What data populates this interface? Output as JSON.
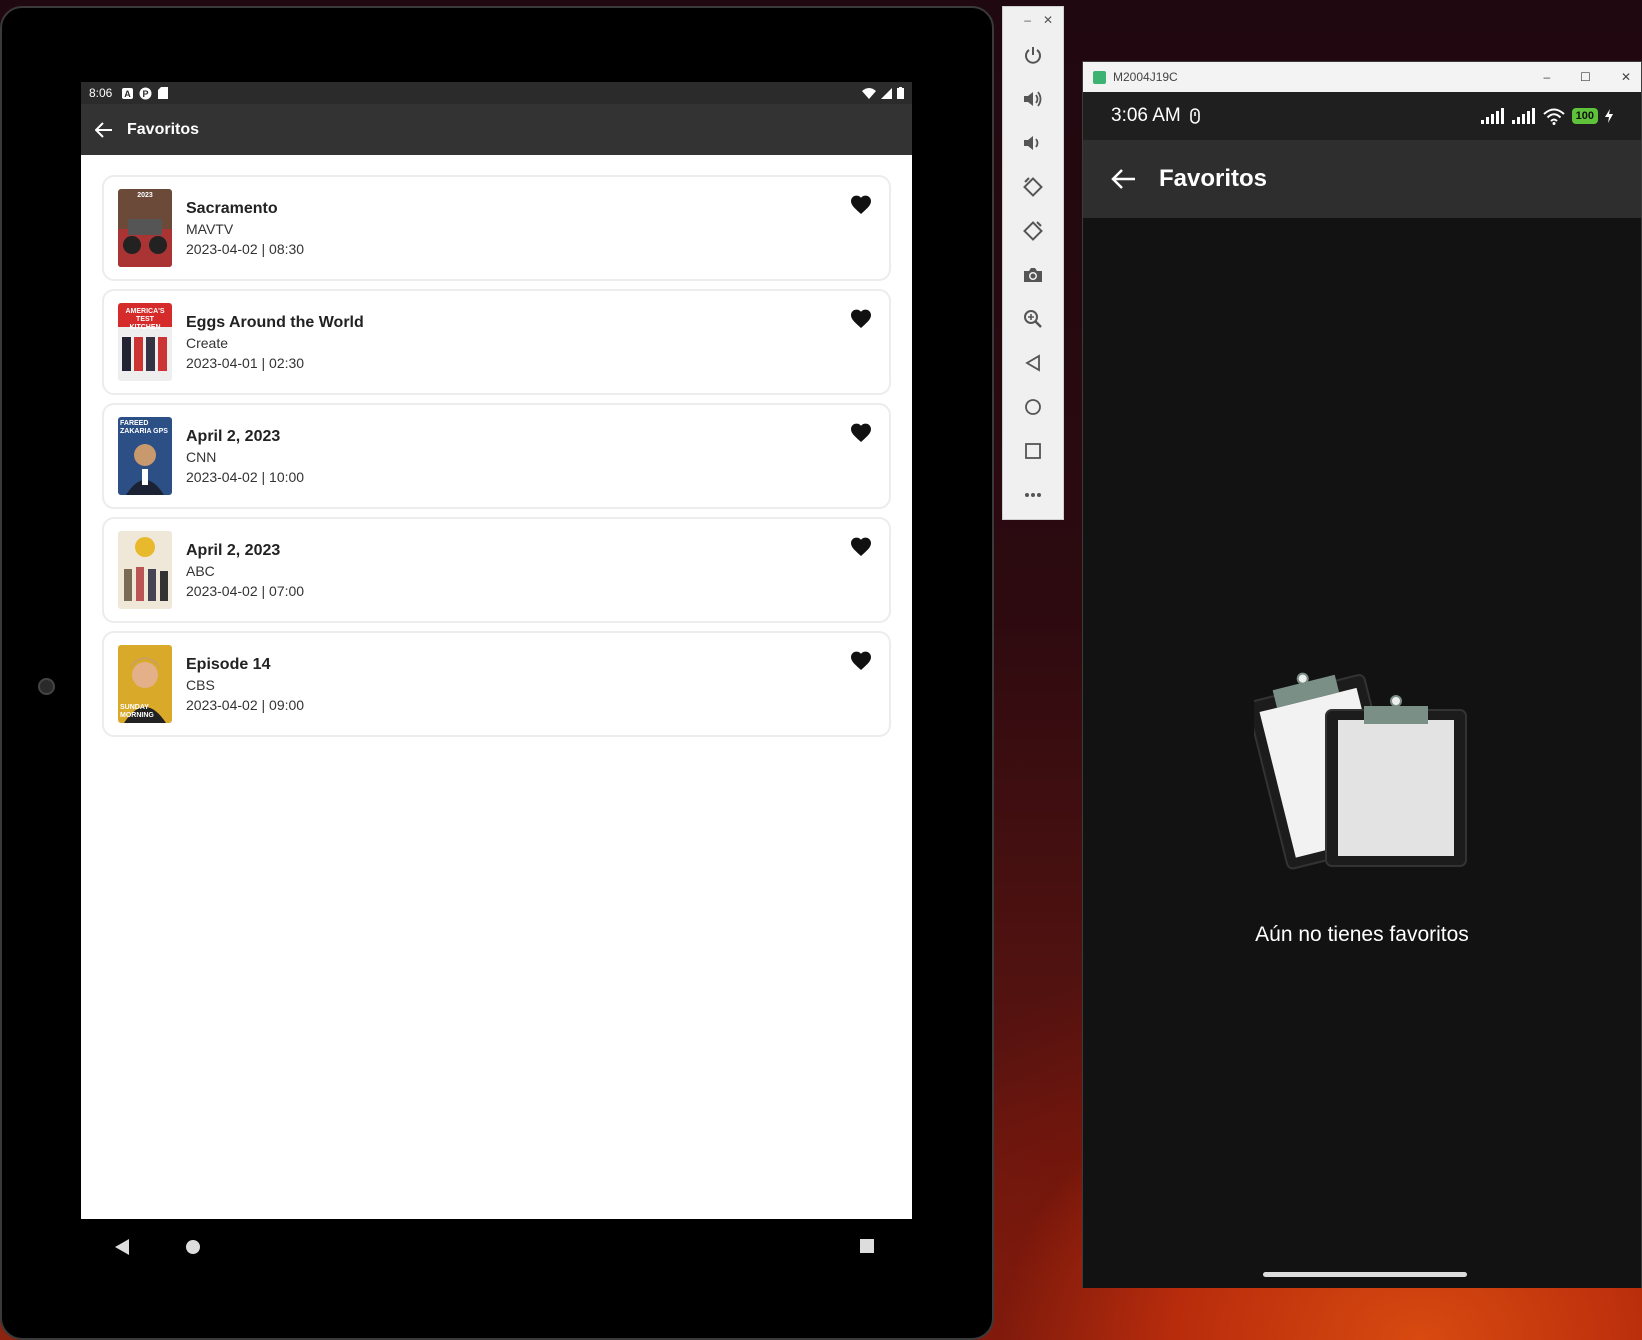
{
  "tablet": {
    "status_time": "8:06",
    "app_title": "Favoritos",
    "favorites": [
      {
        "title": "Sacramento",
        "channel": "MAVTV",
        "datetime": "2023-04-02 | 08:30",
        "thumb_color": "#6b4a3a",
        "thumb_text": "2023"
      },
      {
        "title": "Eggs Around the World",
        "channel": "Create",
        "datetime": "2023-04-01 | 02:30",
        "thumb_color": "#d52b2b",
        "thumb_text": "AMERICA'S TEST KITCHEN"
      },
      {
        "title": "April 2, 2023",
        "channel": "CNN",
        "datetime": "2023-04-02 | 10:00",
        "thumb_color": "#2c4f86",
        "thumb_text": "FAREED ZAKARIA GPS"
      },
      {
        "title": "April 2, 2023",
        "channel": "ABC",
        "datetime": "2023-04-02 | 07:00",
        "thumb_color": "#b89a55",
        "thumb_text": ""
      },
      {
        "title": "Episode 14",
        "channel": "CBS",
        "datetime": "2023-04-02 | 09:00",
        "thumb_color": "#d9a92a",
        "thumb_text": "SUNDAY MORNING"
      }
    ]
  },
  "emulator_toolbar": {
    "tools": [
      "power-icon",
      "volume-up-icon",
      "volume-down-icon",
      "rotate-left-icon",
      "rotate-right-icon",
      "camera-icon",
      "zoom-icon",
      "back-icon",
      "home-icon",
      "overview-icon",
      "more-icon"
    ]
  },
  "phone": {
    "window_title": "M2004J19C",
    "status_time": "3:06 AM",
    "battery": "100",
    "app_title": "Favoritos",
    "empty_message": "Aún no tienes favoritos"
  },
  "colors": {
    "tablet_appbar": "#333333",
    "phone_background": "#121212",
    "heart": "#111111"
  }
}
